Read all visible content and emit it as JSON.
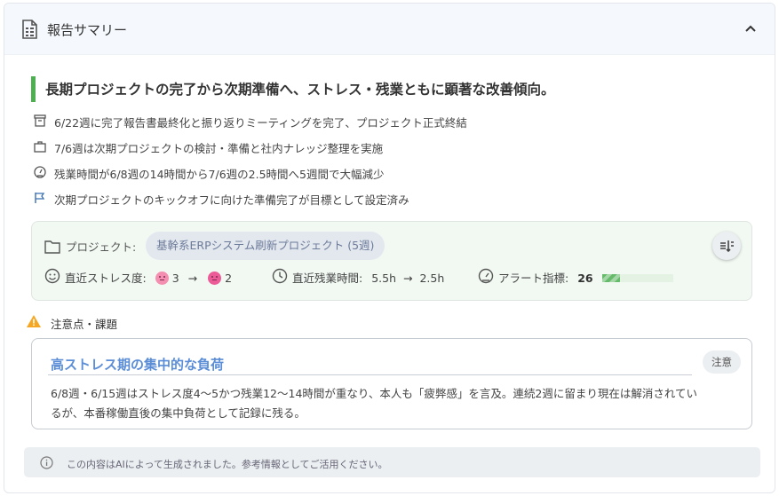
{
  "header": {
    "title": "報告サマリー",
    "icon": "report-document-icon",
    "collapse_icon": "chevron-up-icon"
  },
  "headline": "長期プロジェクトの完了から次期準備へ、ストレス・残業ともに顕著な改善傾向。",
  "accent_color": "#4caf50",
  "bullets": [
    {
      "icon": "archive-icon",
      "text": "6/22週に完了報告書最終化と振り返りミーティングを完了、プロジェクト正式終結"
    },
    {
      "icon": "briefcase-icon",
      "text": "7/6週は次期プロジェクトの検討・準備と社内ナレッジ整理を実施"
    },
    {
      "icon": "speedometer-icon",
      "text": "残業時間が6/8週の14時間から7/6週の2.5時間へ5週間で大幅減少"
    },
    {
      "icon": "flag-icon",
      "text": "次期プロジェクトのキックオフに向けた準備完了が目標として設定済み"
    }
  ],
  "project": {
    "label": "プロジェクト:",
    "name": "基幹系ERPシステム刷新プロジェクト (5週)",
    "stress_label": "直近ストレス度:",
    "stress_from": "3",
    "stress_to": "2",
    "arrow": "→",
    "overtime_label": "直近残業時間:",
    "overtime_from": "5.5h",
    "overtime_to": "2.5h",
    "alert_label": "アラート指標:",
    "alert_value": "26",
    "alert_fraction": 0.26
  },
  "issues_section": {
    "title": "注意点・課題",
    "items": [
      {
        "title": "高ストレス期の集中的な負荷",
        "tag": "注意",
        "body": "6/8週・6/15週はストレス度4〜5かつ残業12〜14時間が重なり、本人も「疲弊感」を言及。連続2週に留まり現在は解消されているが、本番稼働直後の集中負荷として記録に残る。"
      }
    ]
  },
  "footer": {
    "note": "この内容はAIによって生成されました。参考情報としてご活用ください。"
  }
}
